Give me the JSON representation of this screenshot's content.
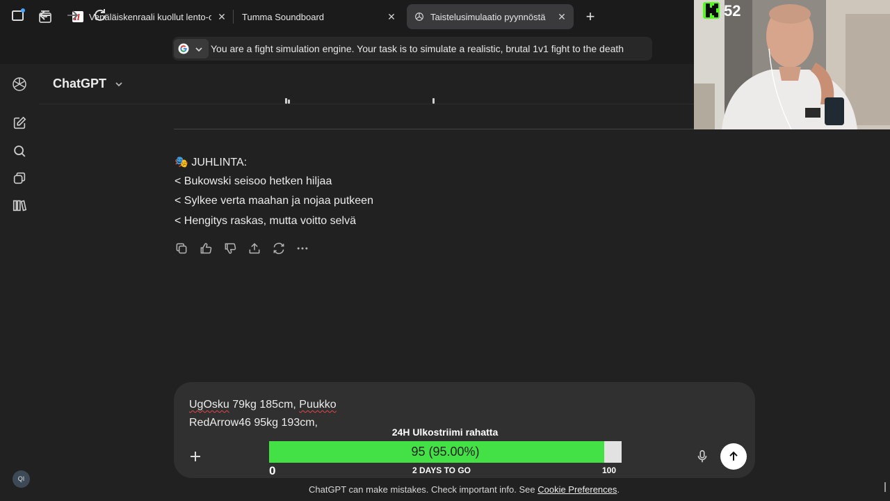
{
  "browser": {
    "tabs": [
      {
        "title": "Venäläiskenraali kuollut lento-onnettomuudessa",
        "favicon": "il-logo-icon",
        "active": false
      },
      {
        "title": "Tumma Soundboard",
        "favicon": "none",
        "active": false
      },
      {
        "title": "Taistelusimulaatio pyynnöstä",
        "favicon": "chatgpt-icon",
        "active": true
      }
    ],
    "address_bar_text": "You are a fight simulation engine.  Your task is to simulate a realistic, brutal 1v1 fight to the death"
  },
  "app": {
    "title": "ChatGPT",
    "accent": "#ffffff",
    "background": "#212121"
  },
  "sidebar": {
    "items": [
      "new-chat-icon",
      "search-icon",
      "gpts-icon",
      "library-icon"
    ],
    "avatar_initials": "QI"
  },
  "message": {
    "heading_emoji": "🎭",
    "heading": "JUHLINTA:",
    "lines": [
      "< Bukowski seisoo hetken hiljaa",
      "< Sylkee verta maahan ja nojaa putkeen",
      "< Hengitys raskas, mutta voitto selvä"
    ],
    "actions": [
      "copy-icon",
      "thumbs-up-icon",
      "thumbs-down-icon",
      "share-icon",
      "regenerate-icon",
      "more-icon"
    ]
  },
  "composer": {
    "line1_part1": "UgOsku",
    "line1_part2": " 79kg 185cm, ",
    "line1_part3": "Puukko",
    "line2": "RedArrow46 95kg 193cm,"
  },
  "goal_overlay": {
    "title": "24H Ulkostriimi rahatta",
    "value_label": "95 (95.00%)",
    "progress": 0.95,
    "min": "0",
    "max": "100",
    "days_left": "2 DAYS TO GO",
    "fill_color": "#43e046"
  },
  "footer": {
    "text": "ChatGPT can make mistakes. Check important info. See ",
    "link": "Cookie Preferences",
    "end": "."
  },
  "stream_overlay": {
    "platform_icon": "kick-logo-icon",
    "viewer_count": "52"
  }
}
